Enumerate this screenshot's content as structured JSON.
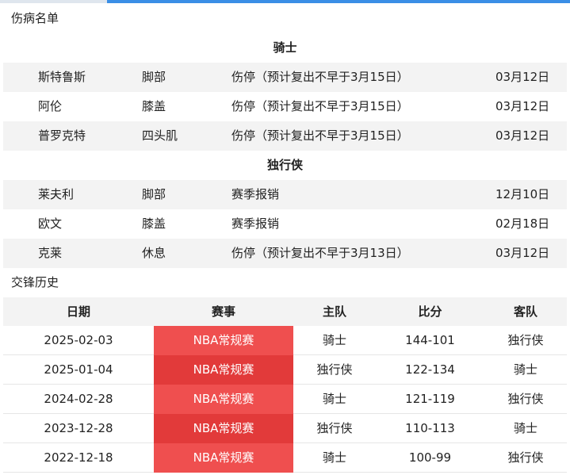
{
  "injury_section": {
    "title": "伤病名单",
    "teams": [
      {
        "name": "骑士",
        "players": [
          {
            "name": "斯特鲁斯",
            "part": "脚部",
            "status": "伤停（预计复出不早于3月15日）",
            "date": "03月12日"
          },
          {
            "name": "阿伦",
            "part": "膝盖",
            "status": "伤停（预计复出不早于3月15日）",
            "date": "03月12日"
          },
          {
            "name": "普罗克特",
            "part": "四头肌",
            "status": "伤停（预计复出不早于3月15日）",
            "date": "03月12日"
          }
        ]
      },
      {
        "name": "独行侠",
        "players": [
          {
            "name": "莱夫利",
            "part": "脚部",
            "status": "赛季报销",
            "date": "12月10日"
          },
          {
            "name": "欧文",
            "part": "膝盖",
            "status": "赛季报销",
            "date": "02月18日"
          },
          {
            "name": "克莱",
            "part": "休息",
            "status": "伤停（预计复出不早于3月13日）",
            "date": "03月12日"
          }
        ]
      }
    ]
  },
  "history_section": {
    "title": "交锋历史",
    "headers": {
      "date": "日期",
      "event": "赛事",
      "home": "主队",
      "score": "比分",
      "away": "客队"
    },
    "rows": [
      {
        "date": "2025-02-03",
        "event": "NBA常规赛",
        "home": "骑士",
        "score": "144-101",
        "away": "独行侠"
      },
      {
        "date": "2025-01-04",
        "event": "NBA常规赛",
        "home": "独行侠",
        "score": "122-134",
        "away": "骑士"
      },
      {
        "date": "2024-02-28",
        "event": "NBA常规赛",
        "home": "骑士",
        "score": "121-119",
        "away": "独行侠"
      },
      {
        "date": "2023-12-28",
        "event": "NBA常规赛",
        "home": "独行侠",
        "score": "110-113",
        "away": "骑士"
      },
      {
        "date": "2022-12-18",
        "event": "NBA常规赛",
        "home": "骑士",
        "score": "100-99",
        "away": "独行侠"
      }
    ]
  },
  "colors": {
    "accent_blue": "#3a8ee6",
    "event_red": "#ef4f4f",
    "row_gray": "#f3f3f3"
  }
}
